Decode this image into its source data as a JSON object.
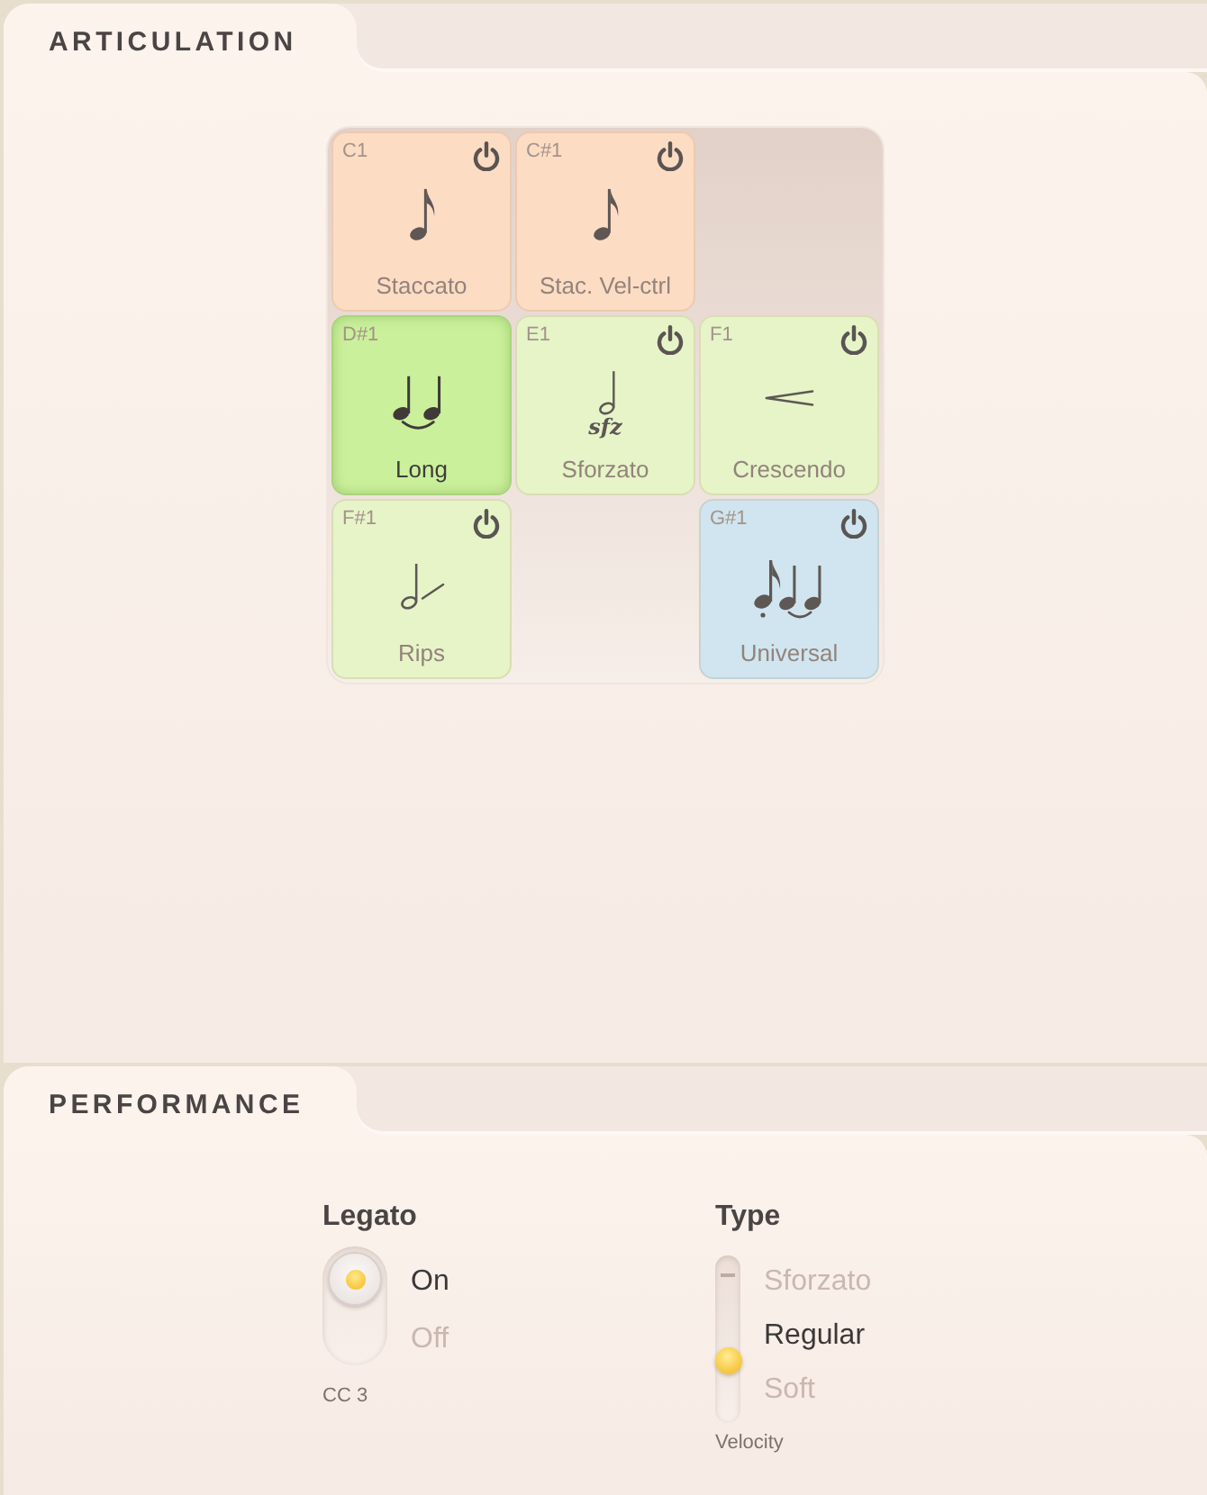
{
  "articulation": {
    "title": "ARTICULATION",
    "cells": [
      {
        "kind": "eighth",
        "note": "C1",
        "label": "Staccato",
        "color": "#fddcc4",
        "selected": false,
        "power": true
      },
      {
        "kind": "eighth",
        "note": "C#1",
        "label": "Stac. Vel-ctrl",
        "color": "#fddcc4",
        "selected": false,
        "power": true
      },
      {
        "kind": "empty"
      },
      {
        "kind": "tied",
        "note": "D#1",
        "label": "Long",
        "color": "#cbf09c",
        "selected": true,
        "power": false
      },
      {
        "kind": "sfz",
        "note": "E1",
        "label": "Sforzato",
        "marking": "sfz",
        "color": "#e6f4c8",
        "selected": false,
        "power": true
      },
      {
        "kind": "hairpin",
        "note": "F1",
        "label": "Crescendo",
        "color": "#e6f4c8",
        "selected": false,
        "power": true
      },
      {
        "kind": "rip",
        "note": "F#1",
        "label": "Rips",
        "color": "#e6f4c8",
        "selected": false,
        "power": true
      },
      {
        "kind": "empty"
      },
      {
        "kind": "mixed",
        "note": "G#1",
        "label": "Universal",
        "color": "#d0e5ef",
        "selected": false,
        "power": true
      }
    ]
  },
  "performance": {
    "title": "PERFORMANCE",
    "controls": [
      {
        "kind": "toggle",
        "label": "Legato",
        "options": [
          {
            "label": "On",
            "selected": true
          },
          {
            "label": "Off",
            "selected": false
          }
        ],
        "caption": "CC 3"
      },
      {
        "kind": "slider",
        "label": "Type",
        "options": [
          {
            "label": "Sforzato",
            "selected": false
          },
          {
            "label": "Regular",
            "selected": true
          },
          {
            "label": "Soft",
            "selected": false
          }
        ],
        "level": 0.34,
        "caption": "Velocity"
      }
    ]
  }
}
